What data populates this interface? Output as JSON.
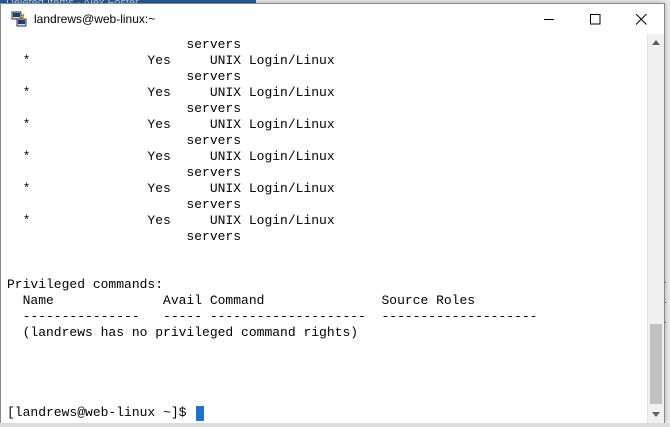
{
  "background": {
    "title": "Deleted Items - Alex Foster",
    "right_chars": [
      "r",
      "t",
      "L",
      "L",
      "L"
    ]
  },
  "window": {
    "title": "landrews@web-linux:~",
    "icon": "putty-icon",
    "minimize": "─",
    "maximize": "☐",
    "close": "✕"
  },
  "terminal": {
    "lines": [
      "                       servers",
      "  *               Yes     UNIX Login/Linux",
      "                       servers",
      "  *               Yes     UNIX Login/Linux",
      "                       servers",
      "  *               Yes     UNIX Login/Linux",
      "                       servers",
      "  *               Yes     UNIX Login/Linux",
      "                       servers",
      "  *               Yes     UNIX Login/Linux",
      "                       servers",
      "  *               Yes     UNIX Login/Linux",
      "                       servers",
      "",
      "",
      "Privileged commands:",
      "  Name              Avail Command               Source Roles",
      "  ---------------   ----- --------------------  --------------------",
      "  (landrews has no privileged command rights)"
    ],
    "prompt": "[landrews@web-linux ~]$ "
  }
}
